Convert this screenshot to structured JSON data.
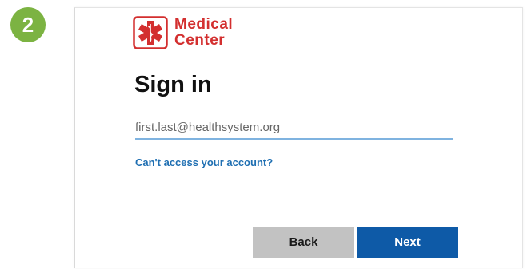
{
  "step": {
    "number": "2",
    "color": "#7cb342"
  },
  "logo": {
    "icon": "star-of-life-icon",
    "line1": "Medical",
    "line2": "Center",
    "color": "#d32f2f"
  },
  "signin": {
    "title": "Sign in",
    "email_placeholder": "first.last@healthsystem.org",
    "help_link": "Can't access your account?",
    "back_label": "Back",
    "next_label": "Next",
    "accent_color": "#0e5aa7"
  }
}
